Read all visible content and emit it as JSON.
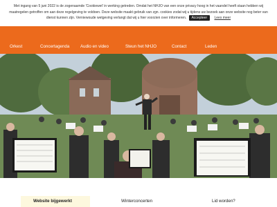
{
  "cookie_banner": {
    "text": "Met ingang van 5 juni 2022 is de zogenaamde 'Cookiewet' in werking getreden. Omdat het NHJO van een onze privacy hoog in het vaandel heeft staan hebben wij maatregelen getroffen om aan deze regelgeving te voldoen. Deze website maakt gebruik van zgn. cookies zodat wij u tijdens uw bezoek aan onze website nog beter van dienst kunnen zijn. Verniewoude wetgeving verlangt dat wij u hier voorzien over informeren.",
    "accept_label": "Accepteer",
    "more_label": "Lees meer"
  },
  "nav": {
    "items": [
      "Orkest",
      "Concertagenda",
      "Audio en video",
      "Steun het NHJO",
      "Contact",
      "Leden"
    ]
  },
  "cards": {
    "website": "Website bijgewerkt",
    "winter": "Winterconcerten",
    "member": "Lid worden?"
  },
  "colors": {
    "brand_orange": "#ec6a1c",
    "card_highlight": "#fdf8de"
  }
}
